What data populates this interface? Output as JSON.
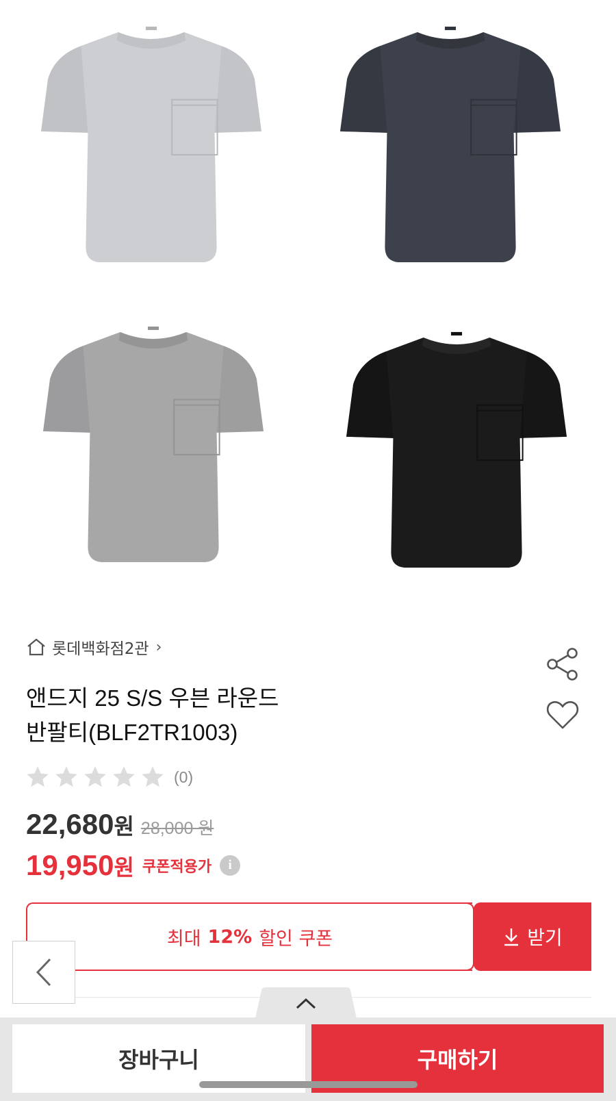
{
  "product_images": [
    {
      "color": "light-grey",
      "body": "#ccced1",
      "shade": "#b6b8bb",
      "collar": "#c0c2c5"
    },
    {
      "color": "navy",
      "body": "#3d414b",
      "shade": "#2f333b",
      "collar": "#33363d"
    },
    {
      "color": "grey",
      "body": "#a7a7a8",
      "shade": "#949495",
      "collar": "#959596"
    },
    {
      "color": "black",
      "body": "#1b1b1c",
      "shade": "#111112",
      "collar": "#262627"
    }
  ],
  "store": {
    "name": "롯데백화점2관",
    "home_icon": "home-icon",
    "chevron": "›"
  },
  "product": {
    "title_line1": "앤드지 25 S/S 우븐 라운드",
    "title_line2": "반팔티(BLF2TR1003)"
  },
  "rating": {
    "stars": 0,
    "max_stars": 5,
    "count": "(0)"
  },
  "price": {
    "sale_value": "22,680",
    "sale_unit": "원",
    "original": "28,000 원",
    "coupon_value": "19,950",
    "coupon_unit": "원",
    "coupon_label": "쿠폰적용가",
    "info_glyph": "i"
  },
  "coupon": {
    "prefix": "최대",
    "percent": "12%",
    "suffix": "할인 쿠폰",
    "get_label": "받기"
  },
  "bottom_bar": {
    "cart_label": "장바구니",
    "buy_label": "구매하기"
  },
  "colors": {
    "accent": "#e5313c"
  }
}
